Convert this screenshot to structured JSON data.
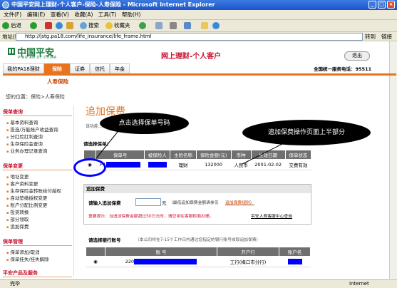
{
  "window": {
    "title": "中国平安网上理财-个人客户-保险-人寿保险 - Microsoft Internet Explorer",
    "btn_min": "_",
    "btn_max": "□",
    "btn_close": "×"
  },
  "menubar": [
    "文件(F)",
    "编辑(E)",
    "查看(V)",
    "收藏(A)",
    "工具(T)",
    "帮助(H)"
  ],
  "toolbar": {
    "back": "后退",
    "forward": "",
    "search": "搜索",
    "favorites": "收藏夹"
  },
  "address": {
    "label": "地址(D)",
    "url": "http://jstg.pa18.com/life_insurance/life_frame.html",
    "go": "转到",
    "links": "链接"
  },
  "header": {
    "logo_cn": "中国平安",
    "logo_en": "PING AN OF CHINA",
    "site_title": "网上理财-个人客户",
    "logout": "退出",
    "hotline": "全国统一服务电话：95511"
  },
  "nav": {
    "tabs": [
      "我的PA18理财",
      "保险",
      "证券",
      "信托",
      "年金"
    ],
    "active": 1,
    "sub_item": "人寿保险"
  },
  "breadcrumb": "您的位置：保险>人寿保险",
  "sidebar": {
    "sections": [
      {
        "title": "保单查询",
        "items": [
          "基本资料查询",
          "投连/万能账户收益查询",
          "分红险红利查询",
          "生存保险金查询",
          "业务办理记录查询"
        ]
      },
      {
        "title": "保单变更",
        "items": [
          "地址变更",
          "客户资料变更",
          "生存保险金转账给付授权",
          "自动垫缴授权变更",
          "账户分配比例变更",
          "投资转换",
          "部分领取",
          "追加保费"
        ]
      },
      {
        "title": "保单管理",
        "items": [
          "保单添加/取消",
          "保单挂失/挂失解除"
        ]
      },
      {
        "title": "平安产品及服务",
        "items": []
      }
    ]
  },
  "main": {
    "heading": "追加保费",
    "intro": "该功能...",
    "policy_label": "请选择保单：",
    "policy_headers": [
      "保单号",
      "被保险人",
      "主险名称",
      "保险金额(元)",
      "币种",
      "生效日期",
      "保单状态"
    ],
    "policy_rows": [
      {
        "no": "P1",
        "insured": "",
        "product": "理财",
        "amount": "132000",
        "currency": "人民币",
        "date": "2001-02-02",
        "status": "交费有效"
      }
    ],
    "add_title": "追加保费",
    "amount_label": "请输入追加保费",
    "amount_unit": "元",
    "amount_note": "（最低追加保费金额请参见",
    "amount_link": "追加保费规则",
    "amount_note_end": "）",
    "tip": "重要提示：当追加保费金额超过50万元时，请您亲往客服柜面办理。",
    "query_link": "平安人寿客服中心查询",
    "bank_label": "请选择银行账号",
    "bank_note": "（本公司将在7-15个工作日内通过您指定的银行账号收取追加保费）",
    "bank_headers": [
      "账 号",
      "开户行",
      "账户名"
    ],
    "bank_rows": [
      {
        "acct": "220",
        "bank": "工行(梅口市分行)",
        "name": ""
      }
    ]
  },
  "annotations": {
    "callout1": "点击选择保单号码",
    "callout2": "追加保费操作页面上半部分"
  },
  "status": {
    "left": "完毕",
    "right": "Internet"
  }
}
